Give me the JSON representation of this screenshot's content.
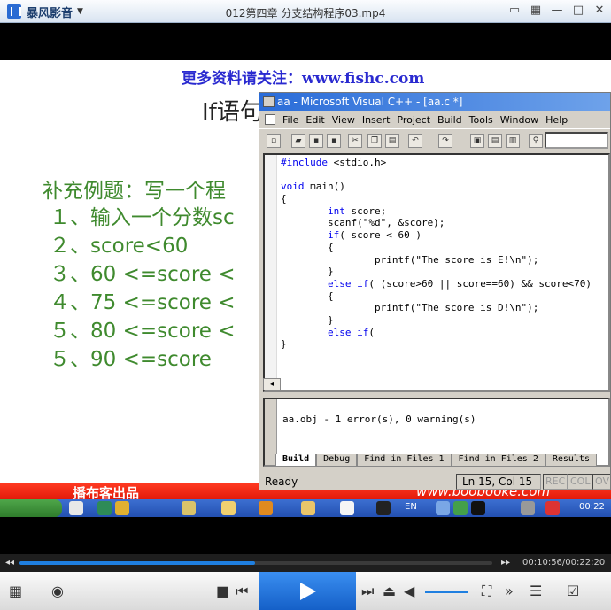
{
  "player": {
    "app_name": "暴风影音",
    "file_title": "012第四章 分支结构程序03.mp4",
    "window_buttons": [
      "▭",
      "▦",
      "—",
      "□",
      "✕"
    ]
  },
  "slide": {
    "promo": "更多资料请关注：www.fishc.com",
    "title": "If语句",
    "heading": "补充例题：写一个程",
    "lines": [
      "１、输入一个分数sc",
      "２、score<60",
      "３、60 <=score <",
      "４、75 <=score <",
      "５、80 <=score <",
      "５、90 <=score"
    ],
    "publisher": "播布客出品",
    "site": "www.boobooke.com"
  },
  "vc": {
    "title": "aa - Microsoft Visual C++ - [aa.c *]",
    "menu": [
      "File",
      "Edit",
      "View",
      "Insert",
      "Project",
      "Build",
      "Tools",
      "Window",
      "Help"
    ],
    "code_lines": [
      {
        "text": "#include <stdio.h>",
        "kw": ""
      },
      {
        "text": "",
        "kw": ""
      },
      {
        "text": "void main()",
        "kw": ""
      },
      {
        "text": "{",
        "kw": ""
      },
      {
        "text": "        int score;",
        "kw": ""
      },
      {
        "text": "        scanf(\"%d\", &score);",
        "kw": ""
      },
      {
        "text": "        if( score < 60 )",
        "kw": ""
      },
      {
        "text": "        {",
        "kw": ""
      },
      {
        "text": "                printf(\"The score is E!\\n\");",
        "kw": ""
      },
      {
        "text": "        }",
        "kw": ""
      },
      {
        "text": "        else if( (score>60 || score==60) && score<70)",
        "kw": ""
      },
      {
        "text": "        {",
        "kw": ""
      },
      {
        "text": "                printf(\"The score is D!\\n\");",
        "kw": ""
      },
      {
        "text": "        }",
        "kw": ""
      },
      {
        "text": "        else if(",
        "kw": ""
      },
      {
        "text": "}",
        "kw": ""
      }
    ],
    "output_message": "aa.obj - 1 error(s), 0 warning(s)",
    "output_tabs": [
      "Build",
      "Debug",
      "Find in Files 1",
      "Find in Files 2",
      "Results"
    ],
    "status_ready": "Ready",
    "status_position": "Ln 15, Col 15",
    "status_indicators": [
      "REC",
      "COL",
      "OVR"
    ]
  },
  "taskbar": {
    "lang": "EN",
    "clock": "00:22"
  },
  "playback": {
    "progress": 0.498,
    "timecode": "00:10:56/00:22:20",
    "volume": 0.7
  }
}
